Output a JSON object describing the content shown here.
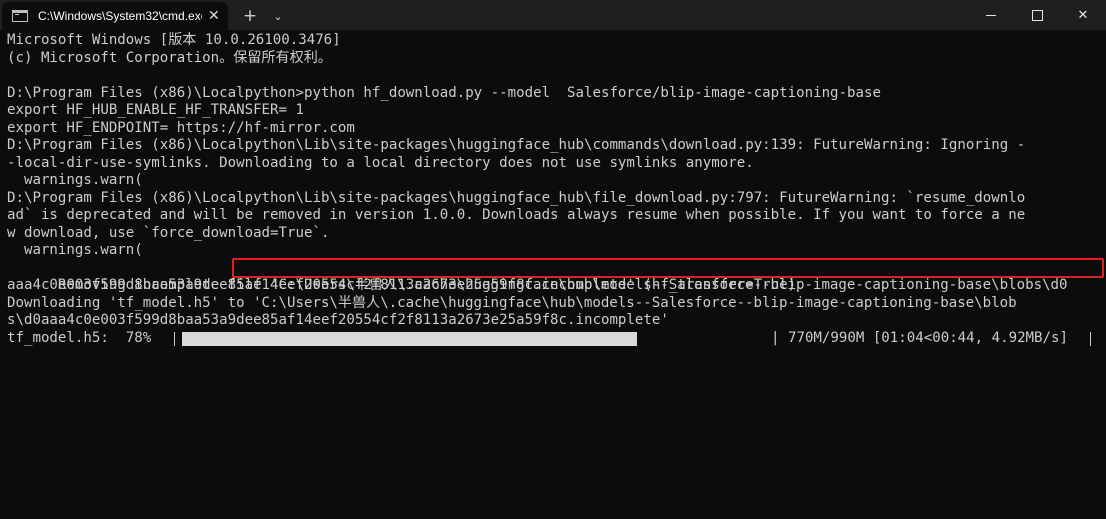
{
  "tab": {
    "title": "C:\\Windows\\System32\\cmd.exe",
    "icon": "terminal-icon"
  },
  "titlebar": {
    "new_tab": "+",
    "dropdown": "⌄",
    "close_tab": "✕",
    "minimize": "minimize-icon",
    "maximize": "maximize-icon",
    "close": "✕"
  },
  "terminal": {
    "lines": [
      "Microsoft Windows [版本 10.0.26100.3476]",
      "(c) Microsoft Corporation。保留所有权利。",
      "",
      "D:\\Program Files (x86)\\Localpython>python hf_download.py --model  Salesforce/blip-image-captioning-base",
      "export HF_HUB_ENABLE_HF_TRANSFER= 1",
      "export HF_ENDPOINT= https://hf-mirror.com",
      "D:\\Program Files (x86)\\Localpython\\Lib\\site-packages\\huggingface_hub\\commands\\download.py:139: FutureWarning: Ignoring -",
      "-local-dir-use-symlinks. Downloading to a local directory does not use symlinks anymore.",
      "  warnings.warn(",
      "D:\\Program Files (x86)\\Localpython\\Lib\\site-packages\\huggingface_hub\\file_download.py:797: FutureWarning: `resume_downlo",
      "ad` is deprecated and will be removed in version 1.0.0. Downloads always resume when possible. If you want to force a ne",
      "w download, use `force_download=True`.",
      "  warnings.warn(",
      "Removing incomplete file 'C:\\Users\\半兽人\\.cache\\huggingface\\hub\\models--Salesforce--blip-image-captioning-base\\blobs\\d0",
      "aaa4c0e003f599d8baa53a9dee85af14eef20554cf2f8113a2673e25a59f8c.incomplete' (hf_transfer=True)",
      "Downloading 'tf_model.h5' to 'C:\\Users\\半兽人\\.cache\\huggingface\\hub\\models--Salesforce--blip-image-captioning-base\\blob",
      "s\\d0aaa4c0e003f599d8baa53a9dee85af14eef20554cf2f8113a2673e25a59f8c.incomplete'"
    ],
    "progress": {
      "label": "tf_model.h5:  78%",
      "fraction": 0.78,
      "stats": "| 770M/990M [01:04<00:44, 4.92MB/s]"
    },
    "highlight_color": "#e41f1f"
  }
}
